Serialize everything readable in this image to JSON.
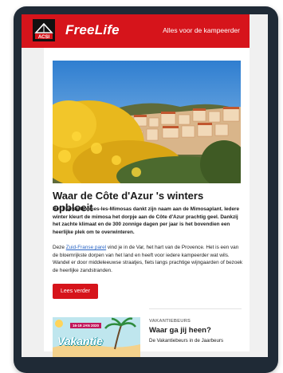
{
  "header": {
    "logo_text": "ACSI",
    "brand": "FreeLife",
    "tagline": "Alles voor de kampeerder"
  },
  "article": {
    "title": "Waar de Côte d'Azur 's winters opbloeit",
    "intro": "Het Franse Bormes-les-Mimosas dankt zijn naam aan de Mimosaplant. Iedere winter kleurt de mimosa het dorpje aan de Côte d'Azur prachtig geel. Dankzij het zachte klimaat en de 300 zonnige dagen per jaar is het bovendien een heerlijke plek om te overwinteren.",
    "body_before": "Deze ",
    "body_link": "Zuid-Franse parel",
    "body_after": " vind je in de Var, het hart van de Provence. Het is een van de bloemrijkste dorpen van het land en heeft voor iedere kampeerder wat wils. Wandel er door middeleeuwse straatjes, fiets langs prachtige wijngaarden of bezoek de heerlijke zandstranden.",
    "cta_label": "Lees verder"
  },
  "teaser": {
    "thumb_date": "16-19 JAN 2020",
    "thumb_word": "Vakantie",
    "label": "VAKANTIEBEURS",
    "title": "Waar ga jij heen?",
    "text": "De Vakantiebeurs in de Jaarbeurs"
  },
  "colors": {
    "brand_red": "#d6141b",
    "device_frame": "#1f2a36",
    "link_blue": "#2b66c5"
  }
}
